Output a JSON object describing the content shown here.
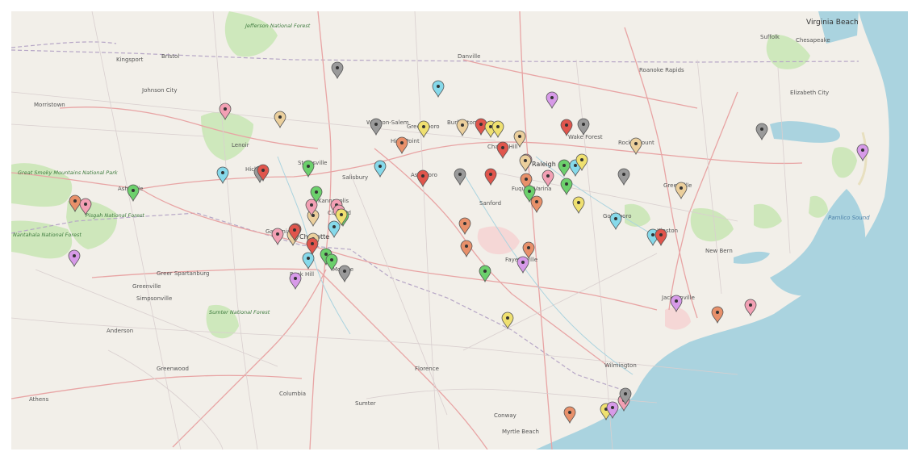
{
  "map": {
    "labels": {
      "jefferson_forest": "Jefferson National Forest",
      "virginia_beach": "Virginia Beach",
      "chesapeake": "Chesapeake",
      "suffolk": "Suffolk",
      "danville": "Danville",
      "kingsport": "Kingsport",
      "bristol": "Bristol",
      "johnson_city": "Johnson City",
      "morristown": "Morristown",
      "roanoke_rapids": "Roanoke Rapids",
      "elizabeth_city": "Elizabeth City",
      "winston_salem": "Winston-Salem",
      "greensboro": "Greensboro",
      "burlington": "Burlington",
      "high_point": "High Point",
      "chapel_hill": "Chapel Hill",
      "wake_forest": "Wake Forest",
      "rocky_mount": "Rocky Mount",
      "raleigh": "Raleigh",
      "lenoir": "Lenoir",
      "hickory": "Hickory",
      "statesville": "Statesville",
      "salisbury": "Salisbury",
      "asheboro": "Asheboro",
      "kannapolis": "Kannapolis",
      "concord": "Concord",
      "fuquay_varina": "Fuquay-Varina",
      "greenville_nc": "Greenville",
      "asheville": "Asheville",
      "great_smoky": "Great Smoky Mountains National Park",
      "sanford": "Sanford",
      "goldsboro": "Goldsboro",
      "kinston": "Kinston",
      "pisgah": "Pisgah National Forest",
      "gastonia": "Gastonia",
      "charlotte": "Charlotte",
      "nantahala": "Nantahala National Forest",
      "fayetteville": "Fayetteville",
      "pamlico": "Pamlico Sound",
      "new_bern": "New Bern",
      "monroe": "Monroe",
      "rock_hill": "Rock Hill",
      "greer_spartanburg": "Greer Spartanburg",
      "greenville_sc": "Greenville",
      "simpsonville": "Simpsonville",
      "jacksonville": "Jacksonville",
      "sumter_forest": "Sumter National Forest",
      "anderson": "Anderson",
      "greenwood": "Greenwood",
      "florence": "Florence",
      "wilmington": "Wilmington",
      "athens": "Athens",
      "columbia": "Columbia",
      "sumter": "Sumter",
      "conway": "Conway",
      "myrtle_beach": "Myrtle Beach"
    },
    "marker_colors": {
      "red": "#e0554c",
      "orange": "#e8906a",
      "yellow": "#efe070",
      "green": "#6cd06c",
      "cyan": "#86d9ea",
      "pink": "#f2a0b4",
      "purple": "#d79ae8",
      "tan": "#ebcf9c",
      "gray": "#9a9a9a"
    },
    "markers": [
      {
        "color": "gray"
      },
      {
        "color": "cyan"
      },
      {
        "color": "purple"
      },
      {
        "color": "pink"
      },
      {
        "color": "tan"
      },
      {
        "color": "gray"
      },
      {
        "color": "yellow"
      },
      {
        "color": "tan"
      },
      {
        "color": "red"
      },
      {
        "color": "yellow"
      },
      {
        "color": "yellow"
      },
      {
        "color": "tan"
      },
      {
        "color": "red"
      },
      {
        "color": "gray"
      },
      {
        "color": "gray"
      },
      {
        "color": "orange"
      },
      {
        "color": "red"
      },
      {
        "color": "tan"
      },
      {
        "color": "purple"
      },
      {
        "color": "pink"
      },
      {
        "color": "green"
      },
      {
        "color": "cyan"
      },
      {
        "color": "yellow"
      },
      {
        "color": "gray"
      },
      {
        "color": "tan"
      },
      {
        "color": "cyan"
      },
      {
        "color": "gray"
      },
      {
        "color": "red"
      },
      {
        "color": "green"
      },
      {
        "color": "cyan"
      },
      {
        "color": "red"
      },
      {
        "color": "gray"
      },
      {
        "color": "red"
      },
      {
        "color": "orange"
      },
      {
        "color": "pink"
      },
      {
        "color": "green"
      },
      {
        "color": "green"
      },
      {
        "color": "orange"
      },
      {
        "color": "green"
      },
      {
        "color": "orange"
      },
      {
        "color": "yellow"
      },
      {
        "color": "tan"
      },
      {
        "color": "tan"
      },
      {
        "color": "pink"
      },
      {
        "color": "orange"
      },
      {
        "color": "pink"
      },
      {
        "color": "green"
      },
      {
        "color": "green"
      },
      {
        "color": "pink"
      },
      {
        "color": "pink"
      },
      {
        "color": "yellow"
      },
      {
        "color": "tan"
      },
      {
        "color": "cyan"
      },
      {
        "color": "red"
      },
      {
        "color": "tan"
      },
      {
        "color": "pink"
      },
      {
        "color": "red"
      },
      {
        "color": "red"
      },
      {
        "color": "cyan"
      },
      {
        "color": "cyan"
      },
      {
        "color": "red"
      },
      {
        "color": "orange"
      },
      {
        "color": "orange"
      },
      {
        "color": "green"
      },
      {
        "color": "purple"
      },
      {
        "color": "cyan"
      },
      {
        "color": "green"
      },
      {
        "color": "green"
      },
      {
        "color": "gray"
      },
      {
        "color": "purple"
      },
      {
        "color": "purple"
      },
      {
        "color": "yellow"
      },
      {
        "color": "purple"
      },
      {
        "color": "orange"
      },
      {
        "color": "pink"
      },
      {
        "color": "orange"
      },
      {
        "color": "yellow"
      },
      {
        "color": "purple"
      },
      {
        "color": "pink"
      },
      {
        "color": "gray"
      }
    ]
  }
}
